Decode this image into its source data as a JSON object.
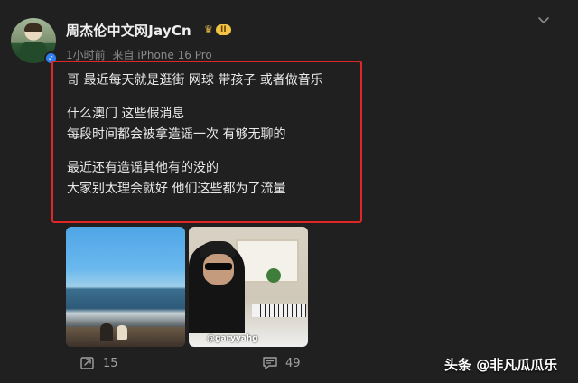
{
  "author": {
    "name": "周杰伦中文网JayCn",
    "level_badge": "II",
    "time": "1小时前",
    "source": "来自 iPhone 16 Pro"
  },
  "post": {
    "lines_group1": [
      "哥 最近每天就是逛街 网球 带孩子 或者做音乐"
    ],
    "lines_group2": [
      "什么澳门 这些假消息",
      "每段时间都会被拿造谣一次 有够无聊的"
    ],
    "lines_group3": [
      "最近还有造谣其他有的没的",
      "大家别太理会就好  他们这些都为了流量"
    ]
  },
  "images": {
    "photo2_caption": "@garyyahg"
  },
  "actions": {
    "repost_count": "15",
    "comment_count": "49"
  },
  "watermark": "头条 @非凡瓜瓜乐",
  "icons": [
    "verified-badge-icon",
    "crown-icon",
    "chevron-down-icon",
    "repost-icon",
    "comment-icon"
  ],
  "colors": {
    "highlight_border": "#e02626",
    "vip_gold": "#f3c447",
    "verify_blue": "#2f7ff0"
  }
}
